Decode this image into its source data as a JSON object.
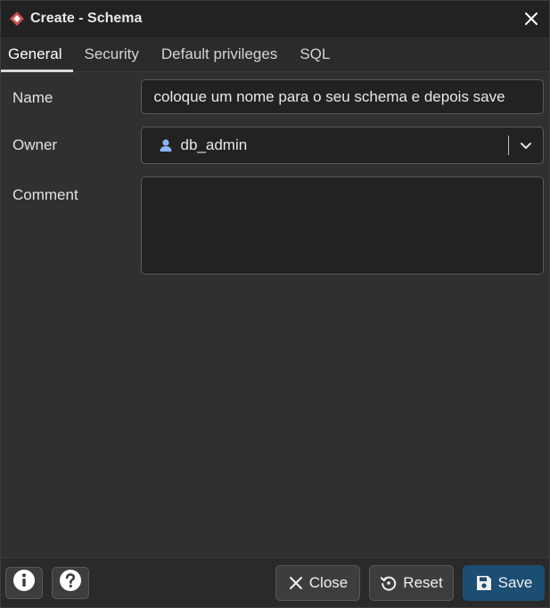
{
  "dialog": {
    "title": "Create - Schema",
    "logo_icon": "pgadmin-diamond-icon",
    "close_icon": "close-icon"
  },
  "tabs": [
    {
      "label": "General",
      "active": true
    },
    {
      "label": "Security",
      "active": false
    },
    {
      "label": "Default privileges",
      "active": false
    },
    {
      "label": "SQL",
      "active": false
    }
  ],
  "form": {
    "name_label": "Name",
    "name_value": "coloque um nome para o seu schema e depois save",
    "owner_label": "Owner",
    "owner_value": "db_admin",
    "owner_icon": "user-icon",
    "comment_label": "Comment",
    "comment_value": ""
  },
  "footer": {
    "info_icon": "info-icon",
    "help_icon": "help-icon",
    "close_label": "Close",
    "reset_label": "Reset",
    "save_label": "Save"
  },
  "colors": {
    "background": "#303030",
    "titlebar": "#222222",
    "input_bg": "#222222",
    "primary": "#1c4e74",
    "user_icon": "#8ab4f8"
  }
}
